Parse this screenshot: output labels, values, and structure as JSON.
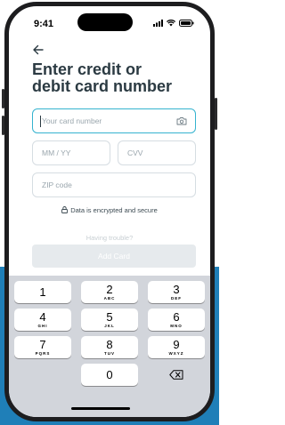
{
  "status_bar": {
    "time": "9:41"
  },
  "icons": {
    "back": "arrow-left-icon",
    "camera": "camera-icon",
    "lock": "lock-icon",
    "backspace": "backspace-icon",
    "signal": "signal-icon",
    "wifi": "wifi-icon",
    "battery": "battery-icon"
  },
  "page": {
    "title": "Enter credit or\ndebit card number"
  },
  "form": {
    "card_number_placeholder": "Your card number",
    "expiry_placeholder": "MM / YY",
    "cvv_placeholder": "CVV",
    "zip_placeholder": "ZIP code",
    "secure_note": "Data is encrypted and secure",
    "help_text": "Having trouble?",
    "submit_label": "Add Card"
  },
  "keyboard": {
    "keys": [
      {
        "digit": "1",
        "letters": ""
      },
      {
        "digit": "2",
        "letters": "ABC"
      },
      {
        "digit": "3",
        "letters": "DEF"
      },
      {
        "digit": "4",
        "letters": "GHI"
      },
      {
        "digit": "5",
        "letters": "JKL"
      },
      {
        "digit": "6",
        "letters": "MNO"
      },
      {
        "digit": "7",
        "letters": "PQRS"
      },
      {
        "digit": "8",
        "letters": "TUV"
      },
      {
        "digit": "9",
        "letters": "WXYZ"
      },
      {
        "digit": "0",
        "letters": ""
      }
    ]
  },
  "colors": {
    "accent": "#35b3cf",
    "title": "#2b3a42",
    "background_band": "#1f7fb8",
    "keyboard_bg": "#d2d5db",
    "disabled_button": "#e6eaed"
  }
}
